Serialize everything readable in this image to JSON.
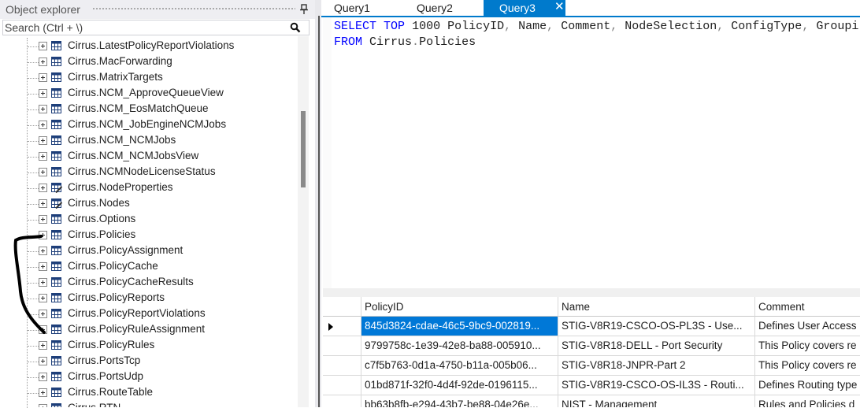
{
  "explorer": {
    "title": "Object explorer",
    "search_placeholder": "Search (Ctrl + \\)",
    "items": [
      {
        "label": "Cirrus.LatestPolicyReportViolations",
        "icon": "table-icon"
      },
      {
        "label": "Cirrus.MacForwarding",
        "icon": "table-icon"
      },
      {
        "label": "Cirrus.MatrixTargets",
        "icon": "table-icon"
      },
      {
        "label": "Cirrus.NCM_ApproveQueueView",
        "icon": "table-icon"
      },
      {
        "label": "Cirrus.NCM_EosMatchQueue",
        "icon": "table-icon"
      },
      {
        "label": "Cirrus.NCM_JobEngineNCMJobs",
        "icon": "table-icon"
      },
      {
        "label": "Cirrus.NCM_NCMJobs",
        "icon": "table-icon"
      },
      {
        "label": "Cirrus.NCM_NCMJobsView",
        "icon": "table-icon"
      },
      {
        "label": "Cirrus.NCMNodeLicenseStatus",
        "icon": "table-icon"
      },
      {
        "label": "Cirrus.NodeProperties",
        "icon": "editable-table-icon"
      },
      {
        "label": "Cirrus.Nodes",
        "icon": "editable-table-icon"
      },
      {
        "label": "Cirrus.Options",
        "icon": "table-icon"
      },
      {
        "label": "Cirrus.Policies",
        "icon": "table-icon"
      },
      {
        "label": "Cirrus.PolicyAssignment",
        "icon": "table-icon"
      },
      {
        "label": "Cirrus.PolicyCache",
        "icon": "table-icon"
      },
      {
        "label": "Cirrus.PolicyCacheResults",
        "icon": "table-icon"
      },
      {
        "label": "Cirrus.PolicyReports",
        "icon": "table-icon"
      },
      {
        "label": "Cirrus.PolicyReportViolations",
        "icon": "table-icon"
      },
      {
        "label": "Cirrus.PolicyRuleAssignment",
        "icon": "table-icon"
      },
      {
        "label": "Cirrus.PolicyRules",
        "icon": "table-icon"
      },
      {
        "label": "Cirrus.PortsTcp",
        "icon": "table-icon"
      },
      {
        "label": "Cirrus.PortsUdp",
        "icon": "table-icon"
      },
      {
        "label": "Cirrus.RouteTable",
        "icon": "table-icon"
      },
      {
        "label": "Cirrus.RTN",
        "icon": "table-icon"
      }
    ]
  },
  "tabs": [
    {
      "label": "Query1",
      "active": false
    },
    {
      "label": "Query2",
      "active": false
    },
    {
      "label": "Query3",
      "active": true
    }
  ],
  "editor": {
    "lines": [
      [
        "SELECT",
        "TOP",
        "1000",
        "PolicyID",
        "Name",
        "Comment",
        "NodeSelection",
        "ConfigType",
        "Groupi"
      ],
      [
        "FROM",
        "Cirrus",
        "Policies"
      ]
    ]
  },
  "results": {
    "columns": [
      "PolicyID",
      "Name",
      "Comment"
    ],
    "rows": [
      [
        "845d3824-cdae-46c5-9bc9-002819...",
        "STIG-V8R19-CSCO-OS-PL3S - Use...",
        "Defines User Access"
      ],
      [
        "9799758c-1e39-42e8-ba88-005910...",
        "STIG-V8R18-DELL - Port Security",
        "This Policy covers re"
      ],
      [
        "c7f5b763-0d1a-4750-b11a-005b06...",
        "STIG-V8R18-JNPR-Part 2",
        "This Policy covers re"
      ],
      [
        "01bd871f-32f0-4d4f-92de-0196115...",
        "STIG-V8R19-CSCO-OS-IL3S - Routi...",
        "Defines Routing type"
      ],
      [
        "bb63b8fb-e294-43b7-be88-04e26e...",
        "NIST - Management",
        "Rules and Policies d"
      ]
    ],
    "selected_row": 0
  },
  "colors": {
    "accent": "#007acc",
    "selection": "#0078d7",
    "keyword": "#0000ff"
  }
}
